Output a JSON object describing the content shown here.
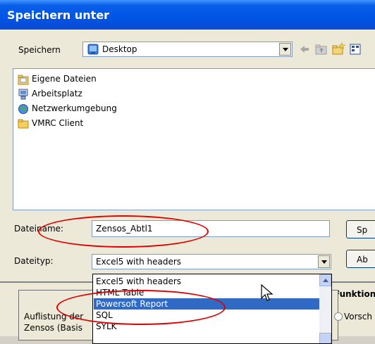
{
  "dialog": {
    "title": "Speichern unter",
    "save_in": {
      "label": "Speichern",
      "value": "Desktop"
    },
    "files": [
      {
        "name": "Eigene Dateien",
        "icon": "my-documents-icon"
      },
      {
        "name": "Arbeitsplatz",
        "icon": "my-computer-icon"
      },
      {
        "name": "Netzwerkumgebung",
        "icon": "network-places-icon"
      },
      {
        "name": "VMRC Client",
        "icon": "folder-icon"
      }
    ],
    "filename": {
      "label": "Dateiname:",
      "value": "Zensos_Abtl1"
    },
    "filetype": {
      "label": "Dateityp:",
      "value": "Excel5 with headers"
    },
    "save_button": "Sp",
    "cancel_button": "Ab"
  },
  "filetype_options": [
    {
      "label": "Excel5 with headers",
      "selected": false
    },
    {
      "label": "HTML Table",
      "selected": false
    },
    {
      "label": "Powersoft Report",
      "selected": true
    },
    {
      "label": "SQL",
      "selected": false
    },
    {
      "label": "SYLK",
      "selected": false
    }
  ],
  "background_window": {
    "group_label": "Funktion",
    "option_label": "Vorsch",
    "text_line1": "Auflistung der",
    "text_line2": "Zensos (Basis"
  },
  "annotations": {
    "color": "#e00000"
  }
}
